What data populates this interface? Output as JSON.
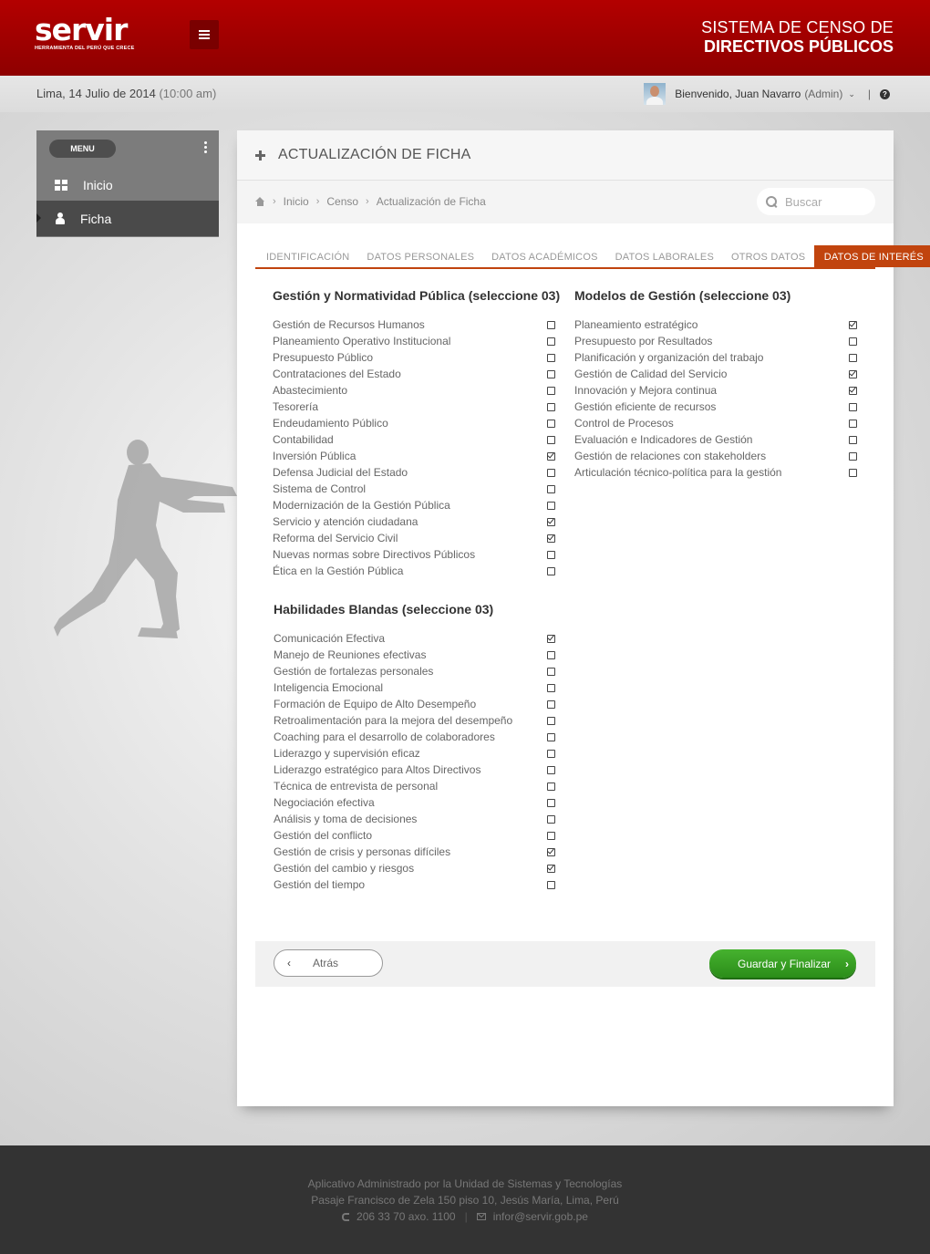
{
  "header": {
    "logo_text": "servir",
    "logo_tagline": "HERRAMIENTA DEL PERÚ QUE CRECE",
    "title_line1": "SISTEMA DE CENSO  DE",
    "title_line2": "DIRECTIVOS PÚBLICOS",
    "brand_color": "#a30000"
  },
  "subbar": {
    "date": "Lima, 14 Julio de 2014",
    "time": "(10:00 am)",
    "welcome": "Bienvenido, Juan Navarro",
    "role": "(Admin)",
    "separator": "|",
    "help_label": "?"
  },
  "sidebar": {
    "menu_label": "MENU",
    "items": [
      {
        "label": "Inicio",
        "icon": "windows-icon",
        "active": false
      },
      {
        "label": "Ficha",
        "icon": "user-icon",
        "active": true
      }
    ]
  },
  "panel": {
    "title": "ACTUALIZACIÓN DE FICHA",
    "breadcrumb": [
      "Inicio",
      "Censo",
      "Actualización de Ficha"
    ],
    "search_placeholder": "Buscar",
    "accent_color": "#c1440e"
  },
  "tabs": [
    {
      "label": "IDENTIFICACIÓN",
      "active": false
    },
    {
      "label": "DATOS PERSONALES",
      "active": false
    },
    {
      "label": "DATOS ACADÉMICOS",
      "active": false
    },
    {
      "label": "DATOS LABORALES",
      "active": false
    },
    {
      "label": "OTROS DATOS",
      "active": false
    },
    {
      "label": "DATOS DE INTERÉS",
      "active": true
    }
  ],
  "sections": {
    "gestion": {
      "title": "Gestión y Normatividad Pública (seleccione 03)",
      "options": [
        {
          "label": "Gestión de Recursos Humanos",
          "checked": false
        },
        {
          "label": "Planeamiento Operativo Institucional",
          "checked": false
        },
        {
          "label": "Presupuesto Público",
          "checked": false
        },
        {
          "label": "Contrataciones del Estado",
          "checked": false
        },
        {
          "label": "Abastecimiento",
          "checked": false
        },
        {
          "label": "Tesorería",
          "checked": false
        },
        {
          "label": "Endeudamiento Público",
          "checked": false
        },
        {
          "label": "Contabilidad",
          "checked": false
        },
        {
          "label": "Inversión Pública",
          "checked": true
        },
        {
          "label": "Defensa Judicial del Estado",
          "checked": false
        },
        {
          "label": "Sistema de Control",
          "checked": false
        },
        {
          "label": "Modernización de la Gestión Pública",
          "checked": false
        },
        {
          "label": "Servicio y atención ciudadana",
          "checked": true
        },
        {
          "label": "Reforma del Servicio Civil",
          "checked": true
        },
        {
          "label": "Nuevas normas sobre Directivos Públicos",
          "checked": false
        },
        {
          "label": "Ética en la Gestión Pública",
          "checked": false
        }
      ]
    },
    "modelos": {
      "title": "Modelos de Gestión (seleccione 03)",
      "options": [
        {
          "label": "Planeamiento estratégico",
          "checked": true
        },
        {
          "label": "Presupuesto por Resultados",
          "checked": false
        },
        {
          "label": "Planificación y organización del trabajo",
          "checked": false
        },
        {
          "label": "Gestión de Calidad del Servicio",
          "checked": true
        },
        {
          "label": "Innovación y Mejora continua",
          "checked": true
        },
        {
          "label": "Gestión eficiente de recursos",
          "checked": false
        },
        {
          "label": "Control de Procesos",
          "checked": false
        },
        {
          "label": "Evaluación e Indicadores de Gestión",
          "checked": false
        },
        {
          "label": "Gestión de relaciones con stakeholders",
          "checked": false
        },
        {
          "label": "Articulación técnico-política para la gestión",
          "checked": false
        }
      ]
    },
    "habilidades": {
      "title": "Habilidades Blandas (seleccione 03)",
      "options": [
        {
          "label": "Comunicación Efectiva",
          "checked": true
        },
        {
          "label": "Manejo de Reuniones efectivas",
          "checked": false
        },
        {
          "label": "Gestión de fortalezas personales",
          "checked": false
        },
        {
          "label": "Inteligencia Emocional",
          "checked": false
        },
        {
          "label": "Formación de Equipo de Alto Desempeño",
          "checked": false
        },
        {
          "label": "Retroalimentación para la mejora del desempeño",
          "checked": false
        },
        {
          "label": "Coaching para el desarrollo de colaboradores",
          "checked": false
        },
        {
          "label": "Liderazgo y supervisión eficaz",
          "checked": false
        },
        {
          "label": "Liderazgo estratégico para Altos Directivos",
          "checked": false
        },
        {
          "label": "Técnica de entrevista de personal",
          "checked": false
        },
        {
          "label": "Negociación efectiva",
          "checked": false
        },
        {
          "label": "Análisis y toma de decisiones",
          "checked": false
        },
        {
          "label": "Gestión del conflicto",
          "checked": false
        },
        {
          "label": "Gestión de crisis y personas difíciles",
          "checked": true
        },
        {
          "label": "Gestión del cambio y riesgos",
          "checked": true
        },
        {
          "label": "Gestión del tiempo",
          "checked": false
        }
      ]
    }
  },
  "actions": {
    "back_label": "Atrás",
    "save_label": "Guardar y Finalizar",
    "save_color": "#3aa124"
  },
  "footer": {
    "line1": "Aplicativo Administrado por la Unidad de Sistemas y Tecnologías",
    "line2": "Pasaje Francisco de Zela 150 piso 10, Jesús María, Lima, Perú",
    "phone": "206 33 70 axo. 1100",
    "separator": "|",
    "email": "infor@servir.gob.pe"
  }
}
